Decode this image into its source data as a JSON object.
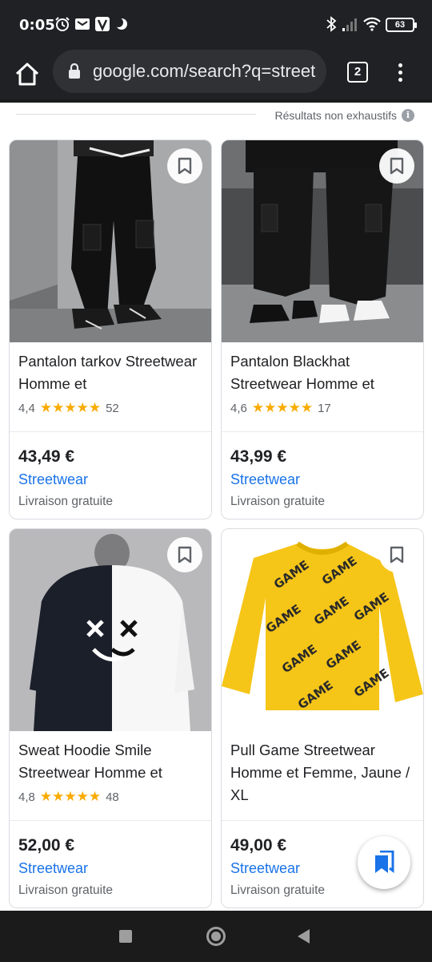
{
  "status_bar": {
    "time": "0:05",
    "battery": "63",
    "icons": [
      "alarm-icon",
      "mail-icon",
      "v-app-icon",
      "moon-icon",
      "bluetooth-icon",
      "signal-icon",
      "wifi-icon",
      "battery-icon"
    ]
  },
  "browser": {
    "url": "google.com/search?q=street",
    "tab_count": "2"
  },
  "results_note": "Résultats non exhaustifs",
  "products": [
    {
      "title": "Pantalon tarkov Streetwear Homme et",
      "rating": "4,4",
      "stars": "★★★★★",
      "reviews": "52",
      "price": "43,49 €",
      "store": "Streetwear",
      "shipping": "Livraison gratuite"
    },
    {
      "title": "Pantalon Blackhat Streetwear Homme et",
      "rating": "4,6",
      "stars": "★★★★★",
      "reviews": "17",
      "price": "43,99 €",
      "store": "Streetwear",
      "shipping": "Livraison gratuite"
    },
    {
      "title": "Sweat Hoodie Smile Streetwear Homme et",
      "rating": "4,8",
      "stars": "★★★★★",
      "reviews": "48",
      "price": "52,00 €",
      "store": "Streetwear",
      "shipping": "Livraison gratuite"
    },
    {
      "title": "Pull Game Streetwear Homme et Femme, Jaune / XL",
      "price": "49,00 €",
      "store": "Streetwear",
      "shipping": "Livraison gratuite"
    }
  ],
  "sweater_print": "GAME",
  "colors": {
    "link": "#1a73e8",
    "star": "#f9ab00",
    "chrome_bg": "#202124",
    "sweater": "#f5c518"
  }
}
